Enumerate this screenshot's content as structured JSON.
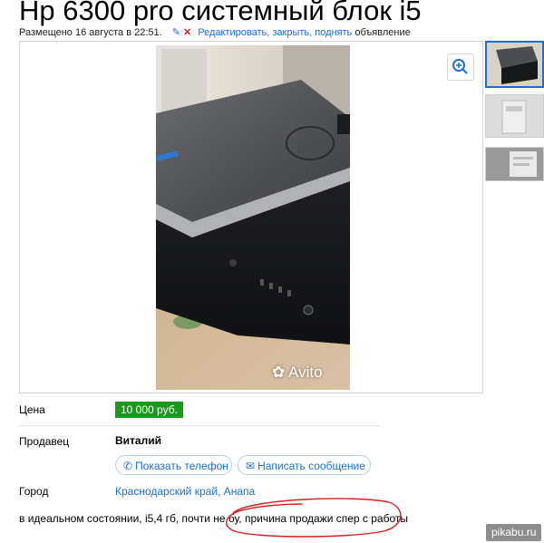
{
  "listing": {
    "title": "Hp 6300 pro системный блок i5",
    "posted": "Размещено 16 августа в 22:51.",
    "edit_links": "Редактировать, закрыть, поднять",
    "edit_suffix": " объявление"
  },
  "gallery": {
    "photo_watermark": "Avito",
    "thumbnail_count": 3
  },
  "details": {
    "price_label": "Цена",
    "price_value": "10 000 руб.",
    "seller_label": "Продавец",
    "seller_name": "Виталий",
    "show_phone": "Показать телефон",
    "write_message": "Написать сообщение",
    "city_label": "Город",
    "city_value": "Краснодарский край, Анапа",
    "description": "в идеальном состоянии, i5,4 гб, почти не бу, причина продажи спер с работы"
  },
  "site_watermark": "pikabu.ru",
  "colors": {
    "link": "#1b6fcf",
    "price_bg": "#1a9a1a",
    "annotation": "#d82020"
  }
}
